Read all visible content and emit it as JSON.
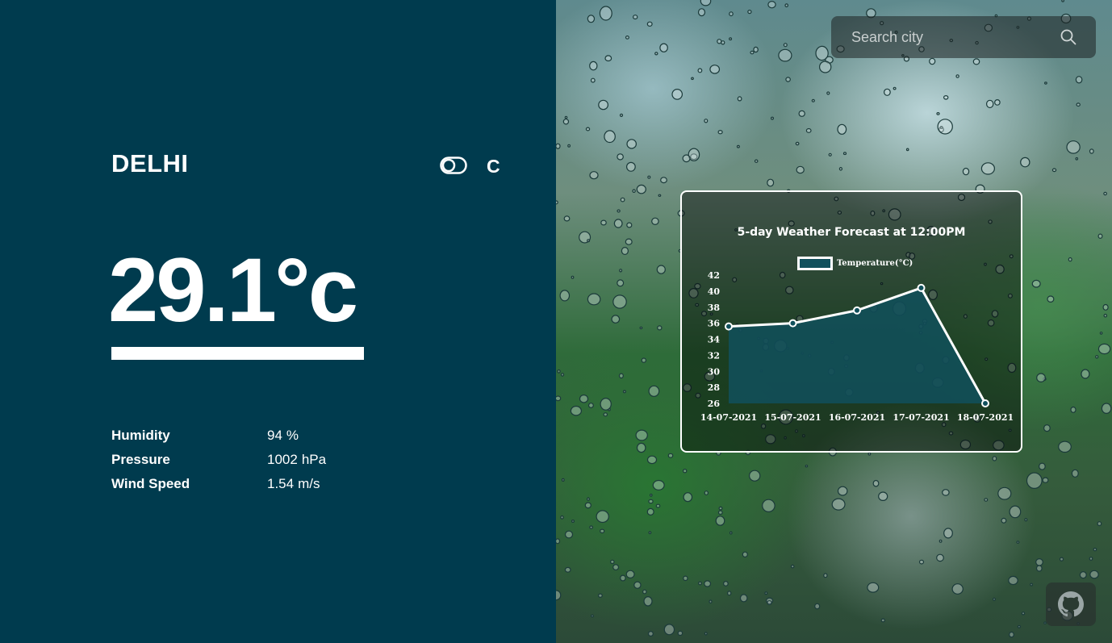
{
  "weather": {
    "city": "DELHI",
    "unit_toggle_icon": "toggle-icon",
    "unit_letter": "C",
    "temperature": "29.1°c",
    "details": [
      {
        "label": "Humidity",
        "value": "94",
        "unit": "%"
      },
      {
        "label": "Pressure",
        "value": "1002",
        "unit": "hPa"
      },
      {
        "label": "Wind Speed",
        "value": "1.54",
        "unit": "m/s"
      }
    ]
  },
  "search": {
    "placeholder": "Search city",
    "value": "",
    "icon": "search-icon"
  },
  "github": {
    "icon": "github-icon"
  },
  "colors": {
    "panel_background": "#003b4e",
    "text": "#ffffff",
    "chart_fill": "#11505c"
  },
  "chart_data": {
    "type": "area",
    "title": "5-day Weather Forecast at 12:00PM",
    "categories": [
      "14-07-2021",
      "15-07-2021",
      "16-07-2021",
      "17-07-2021",
      "18-07-2021"
    ],
    "series": [
      {
        "name": "Temperature(°C)",
        "values": [
          35.6,
          36.0,
          37.6,
          40.4,
          26.0
        ]
      }
    ],
    "y_ticks": [
      26,
      28,
      30,
      32,
      34,
      36,
      38,
      40,
      42
    ],
    "ylim": [
      26,
      42
    ],
    "xlabel": "",
    "ylabel": "",
    "grid": false,
    "legend": "top"
  }
}
